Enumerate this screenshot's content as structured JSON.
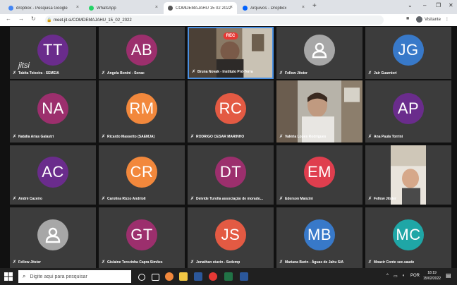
{
  "browser": {
    "tabs": [
      {
        "label": "dropbox - Pesquisa Google",
        "icon_color": "#4285f4"
      },
      {
        "label": "WhatsApp",
        "icon_color": "#25d366"
      },
      {
        "label": "COMDEMAJAHU 15 02 2022",
        "icon_color": "#555555"
      },
      {
        "label": "Arquivos - Dropbox",
        "icon_color": "#0061fe"
      }
    ],
    "close_glyph": "×",
    "new_tab_glyph": "+",
    "url": "meet.jit.si/COMDEMAJAHU_15_02_2022",
    "profile_label": "Visitante"
  },
  "meeting": {
    "logo": "jitsi",
    "rec_label": "REC",
    "participants": [
      {
        "initials": "TT",
        "name": "Tabita Teixeira - SEMEIA",
        "color": "#6a2c8c"
      },
      {
        "initials": "AB",
        "name": "Angela Bonini - Senac",
        "color": "#9c2f6d"
      },
      {
        "initials": "",
        "name": "Bruna Novak - Instituto Pró-Terra",
        "video": true
      },
      {
        "initials": "",
        "name": "Fellow Jitster",
        "default": true
      },
      {
        "initials": "JG",
        "name": "Jair Guarnieri",
        "color": "#3879c9"
      },
      {
        "initials": "NA",
        "name": "Natália Arias Galastri",
        "color": "#9c2f6d"
      },
      {
        "initials": "RM",
        "name": "Ricardo Massetto (SAEMJA)",
        "color": "#f2883c"
      },
      {
        "initials": "RC",
        "name": "RODRIGO CESAR MARINHO",
        "color": "#e35a43"
      },
      {
        "initials": "",
        "name": "Valéria Lopes Rodrigues",
        "video": true
      },
      {
        "initials": "AP",
        "name": "Ana Paula Torrini",
        "color": "#6a2c8c"
      },
      {
        "initials": "AC",
        "name": "André Cazeiro",
        "color": "#6a2c8c"
      },
      {
        "initials": "CR",
        "name": "Carolina Rizzo Andrioli",
        "color": "#f2883c"
      },
      {
        "initials": "DT",
        "name": "Deivide Turolla associação de morado...",
        "color": "#9c2f6d"
      },
      {
        "initials": "EM",
        "name": "Ederson Manzini",
        "color": "#df3e4e"
      },
      {
        "initials": "",
        "name": "Fellow Jitster",
        "video": true
      },
      {
        "initials": "",
        "name": "Fellow Jitster",
        "default": true
      },
      {
        "initials": "GT",
        "name": "Gislaine Terezinha Capra Simões",
        "color": "#9c2f6d"
      },
      {
        "initials": "JS",
        "name": "Jonathan stucin - Sedemp",
        "color": "#e35a43"
      },
      {
        "initials": "MB",
        "name": "Mariana Burin - Águas de Jahu S/A",
        "color": "#3879c9"
      },
      {
        "initials": "MC",
        "name": "Moacir Conte sec.saude",
        "color": "#1fa6a6"
      }
    ]
  },
  "taskbar": {
    "search_placeholder": "Digite aqui para pesquisar",
    "lang": "POR",
    "time": "18:19",
    "date": "15/02/2022"
  }
}
